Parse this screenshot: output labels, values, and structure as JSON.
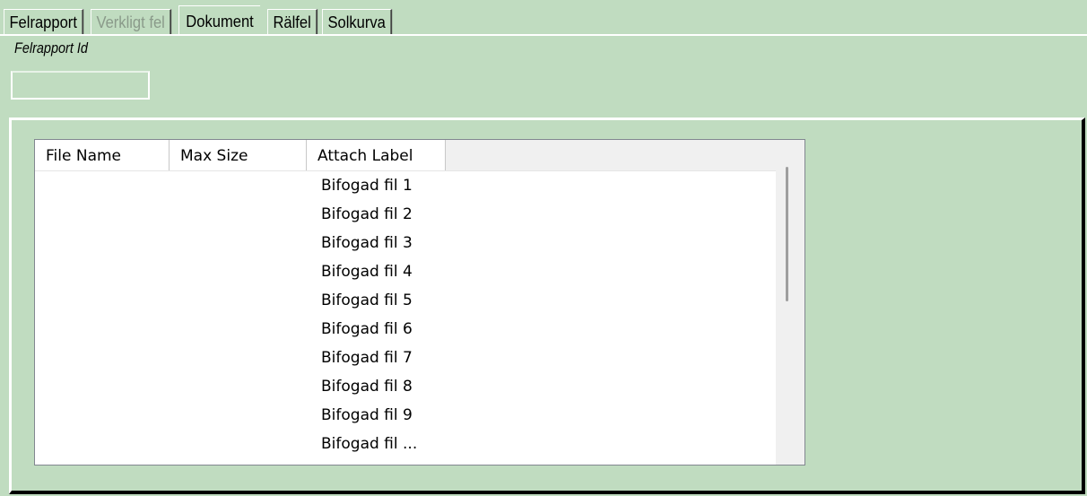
{
  "tabs": [
    {
      "label": "Felrapport",
      "state": "normal"
    },
    {
      "label": "Verkligt fel",
      "state": "disabled"
    },
    {
      "label": "Dokument",
      "state": "active"
    },
    {
      "label": "Rälfel",
      "state": "normal"
    },
    {
      "label": "Solkurva",
      "state": "normal"
    }
  ],
  "felrapport_id": {
    "label": "Felrapport Id",
    "value": ""
  },
  "attachments": {
    "columns": [
      "File Name",
      "Max Size",
      "Attach Label"
    ],
    "rows": [
      {
        "file_name": "",
        "max_size": "",
        "attach_label": "Bifogad fil 1"
      },
      {
        "file_name": "",
        "max_size": "",
        "attach_label": "Bifogad fil 2"
      },
      {
        "file_name": "",
        "max_size": "",
        "attach_label": "Bifogad fil 3"
      },
      {
        "file_name": "",
        "max_size": "",
        "attach_label": "Bifogad fil 4"
      },
      {
        "file_name": "",
        "max_size": "",
        "attach_label": "Bifogad fil 5"
      },
      {
        "file_name": "",
        "max_size": "",
        "attach_label": "Bifogad fil 6"
      },
      {
        "file_name": "",
        "max_size": "",
        "attach_label": "Bifogad fil 7"
      },
      {
        "file_name": "",
        "max_size": "",
        "attach_label": "Bifogad fil 8"
      },
      {
        "file_name": "",
        "max_size": "",
        "attach_label": "Bifogad fil 9"
      },
      {
        "file_name": "",
        "max_size": "",
        "attach_label": "Bifogad fil ..."
      }
    ]
  },
  "colors": {
    "background": "#c0dcc0",
    "disabled_text": "#8a9a8a",
    "list_background": "#ffffff"
  }
}
